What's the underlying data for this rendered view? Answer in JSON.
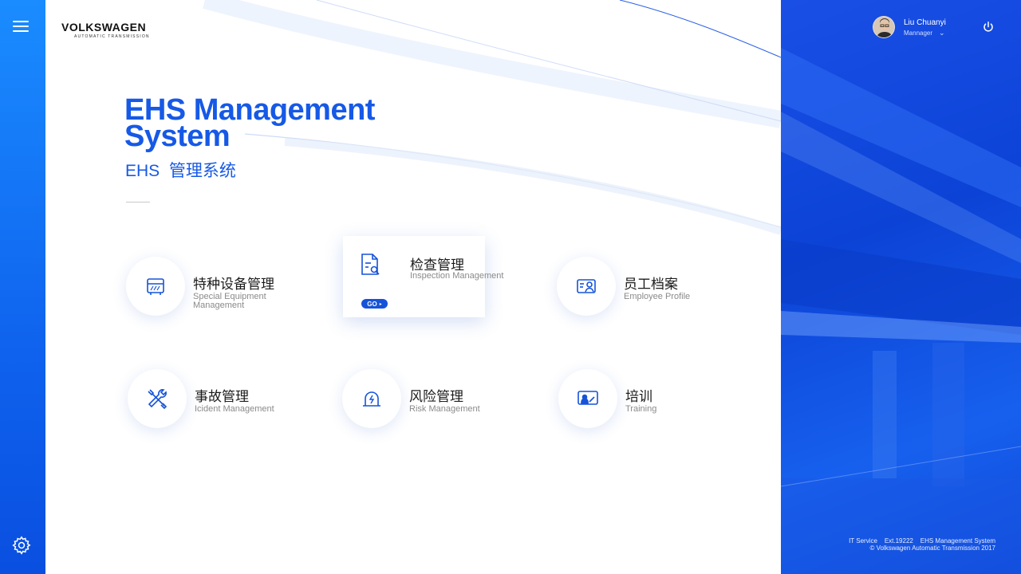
{
  "brand": {
    "name": "VOLKSWAGEN",
    "sub": "AUTOMATIC TRANSMISSION"
  },
  "title": {
    "en_line1": "EHS Management",
    "en_line2": "System",
    "cn": "EHS  管理系统"
  },
  "modules": [
    {
      "id": "special-equipment",
      "cn": "特种设备管理",
      "en": "Special Equipment Management",
      "icon": "cabinet-icon"
    },
    {
      "id": "inspection",
      "cn": "检查管理",
      "en": "Inspection Management",
      "icon": "document-search-icon",
      "active": true,
      "go": "GO"
    },
    {
      "id": "employee-profile",
      "cn": "员工档案",
      "en": "Employee Profile",
      "icon": "id-card-icon"
    },
    {
      "id": "incident",
      "cn": "事故管理",
      "en": "Icident Management",
      "icon": "tools-icon"
    },
    {
      "id": "risk",
      "cn": "风险管理",
      "en": "Risk Management",
      "icon": "alert-lamp-icon"
    },
    {
      "id": "training",
      "cn": "培训",
      "en": "Training",
      "icon": "presentation-icon"
    }
  ],
  "user": {
    "name": "Liu Chuanyi",
    "role": "Mannager"
  },
  "footer": {
    "line1": "IT Service    Ext.19222    EHS Management System",
    "line2": "© Volkswagen Automatic Transmission 2017"
  },
  "colors": {
    "accent": "#1659e6",
    "rail": "#0f63ee",
    "panel": "#0c43d6"
  }
}
